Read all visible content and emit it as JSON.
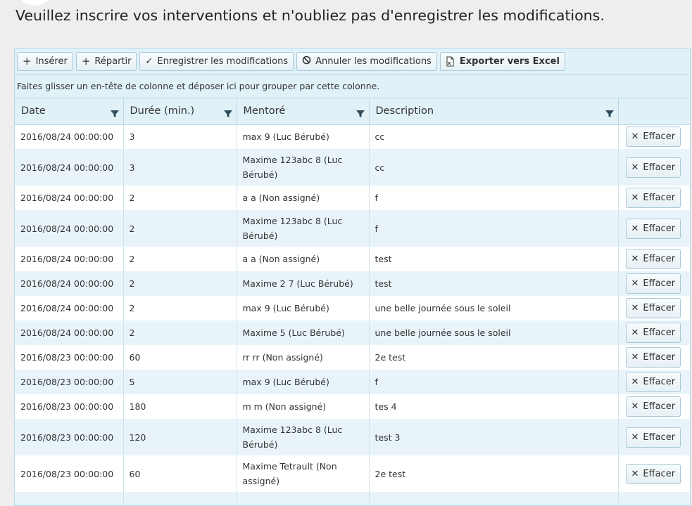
{
  "page": {
    "title": "Veuillez inscrire vos interventions et n'oubliez pas d'enregistrer les modifications."
  },
  "toolbar": {
    "insert_label": "Insérer",
    "split_label": "Répartir",
    "save_label": "Enregistrer les modifications",
    "cancel_label": "Annuler les modifications",
    "export_label": "Exporter vers Excel"
  },
  "group_bar": {
    "hint": "Faites glisser un en-tête de colonne et déposer ici pour grouper par cette colonne."
  },
  "columns": [
    "Date",
    "Durée (min.)",
    "Mentoré",
    "Description"
  ],
  "delete_label": "Effacer",
  "rows": [
    {
      "date": "2016/08/24 00:00:00",
      "duration": "3",
      "mentee": "max 9 (Luc Bérubé)",
      "description": "cc"
    },
    {
      "date": "2016/08/24 00:00:00",
      "duration": "3",
      "mentee": "Maxime 123abc 8 (Luc Bérubé)",
      "description": "cc"
    },
    {
      "date": "2016/08/24 00:00:00",
      "duration": "2",
      "mentee": "a a (Non assigné)",
      "description": "f"
    },
    {
      "date": "2016/08/24 00:00:00",
      "duration": "2",
      "mentee": "Maxime 123abc 8 (Luc Bérubé)",
      "description": "f"
    },
    {
      "date": "2016/08/24 00:00:00",
      "duration": "2",
      "mentee": "a a (Non assigné)",
      "description": "test"
    },
    {
      "date": "2016/08/24 00:00:00",
      "duration": "2",
      "mentee": "Maxime 2 7 (Luc Bérubé)",
      "description": "test"
    },
    {
      "date": "2016/08/24 00:00:00",
      "duration": "2",
      "mentee": "max 9 (Luc Bérubé)",
      "description": "une belle journée sous le soleil"
    },
    {
      "date": "2016/08/24 00:00:00",
      "duration": "2",
      "mentee": "Maxime 5 (Luc Bérubé)",
      "description": "une belle journée sous le soleil"
    },
    {
      "date": "2016/08/23 00:00:00",
      "duration": "60",
      "mentee": "rr rr (Non assigné)",
      "description": "2e test"
    },
    {
      "date": "2016/08/23 00:00:00",
      "duration": "5",
      "mentee": "max 9 (Luc Bérubé)",
      "description": "f"
    },
    {
      "date": "2016/08/23 00:00:00",
      "duration": "180",
      "mentee": "m m (Non assigné)",
      "description": "tes 4"
    },
    {
      "date": "2016/08/23 00:00:00",
      "duration": "120",
      "mentee": "Maxime 123abc 8 (Luc Bérubé)",
      "description": "test 3"
    },
    {
      "date": "2016/08/23 00:00:00",
      "duration": "60",
      "mentee": "Maxime Tetrault (Non assigné)",
      "description": "2e test"
    },
    {
      "date": "",
      "duration": "",
      "mentee": "",
      "description": ""
    }
  ],
  "colors": {
    "header_bg": "#e1f1f8",
    "border": "#b7d9e8",
    "alt_row": "#e8f4f9"
  }
}
